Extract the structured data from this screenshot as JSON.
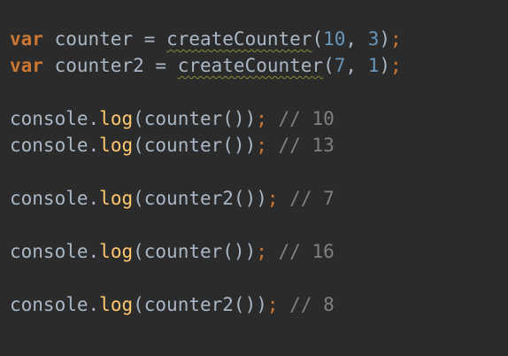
{
  "editor": {
    "lines": [
      {
        "keyword": "var",
        "name": "counter",
        "op": "=",
        "fn": "createCounter",
        "args": [
          "10",
          "3"
        ]
      },
      {
        "keyword": "var",
        "name": "counter2",
        "op": "=",
        "fn": "createCounter",
        "args": [
          "7",
          "1"
        ]
      },
      {
        "object": "console",
        "method": "log",
        "target": "counter",
        "comment": "// 10"
      },
      {
        "object": "console",
        "method": "log",
        "target": "counter",
        "comment": "// 13"
      },
      {
        "object": "console",
        "method": "log",
        "target": "counter2",
        "comment": "// 7"
      },
      {
        "object": "console",
        "method": "log",
        "target": "counter",
        "comment": "// 16"
      },
      {
        "object": "console",
        "method": "log",
        "target": "counter2",
        "comment": "// 8"
      }
    ]
  },
  "colors": {
    "background": "#2b2b2b",
    "keyword": "#cc7832",
    "identifier": "#a9b7c6",
    "method": "#ffc66d",
    "number": "#6897bb",
    "comment": "#808080"
  }
}
